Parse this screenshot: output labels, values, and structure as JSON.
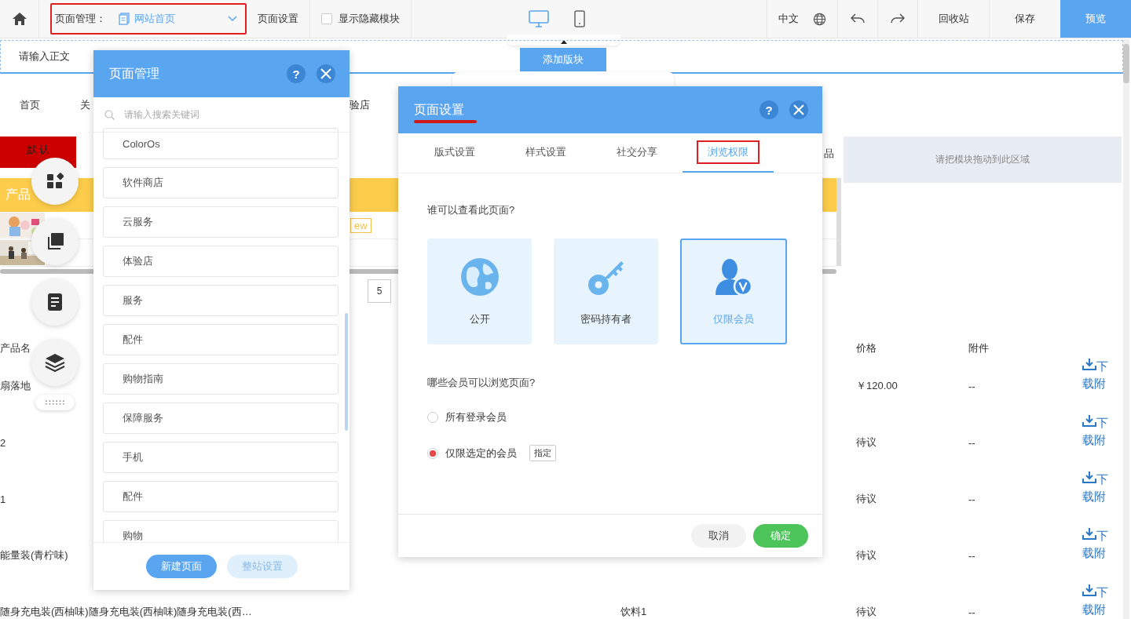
{
  "toolbar": {
    "page_label": "页面管理：",
    "page_select": "网站首页",
    "page_settings": "页面设置",
    "show_hidden": {
      "label": "显示隐藏模块",
      "checked": false
    },
    "devices": [
      {
        "kind": "desktop",
        "selected": true
      },
      {
        "kind": "mobile",
        "selected": false
      }
    ],
    "language": "中文",
    "recycle": "回收站",
    "save": "保存",
    "preview": "预览"
  },
  "canvas": {
    "text_placeholder": "请输入正文",
    "add_block": "添加版块",
    "nav": [
      "首页",
      "关",
      "验店"
    ],
    "default_button": "默 认",
    "banner": "产品",
    "tag": "ew",
    "tab_fragment": "品",
    "drop_zone": "请把模块拖动到此区域",
    "pagination": [
      "5"
    ],
    "table": {
      "columns": [
        "产品名",
        "价格",
        "附件"
      ],
      "rows": [
        {
          "name": "扇落地",
          "price": "￥120.00",
          "attachment": "--",
          "link": "下载附"
        },
        {
          "name": "2",
          "price": "待议",
          "attachment": "--",
          "link": "下载附"
        },
        {
          "name": "1",
          "price": "待议",
          "attachment": "--",
          "link": "下载附"
        },
        {
          "name": "能量装(青柠味)",
          "price": "待议",
          "attachment": "--",
          "link": "下载附"
        },
        {
          "name": "随身充电装(西柚味)随身充电装(西柚味)随身充电装(西…",
          "category": "饮料1",
          "price": "待议",
          "attachment": "--",
          "link": "下载附"
        }
      ]
    }
  },
  "page_manager": {
    "title": "页面管理",
    "help": "?",
    "search_placeholder": "请输入搜索关键词",
    "pages": [
      "ColorOs",
      "软件商店",
      "云服务",
      "体验店",
      "服务",
      "配件",
      "购物指南",
      "保障服务",
      "手机",
      "配件",
      "购物"
    ],
    "buttons": [
      {
        "label": "新建页面",
        "kind": "primary"
      },
      {
        "label": "整站设置",
        "kind": "secondary"
      }
    ]
  },
  "page_settings": {
    "title": "页面设置",
    "help": "?",
    "tabs": [
      {
        "label": "版式设置",
        "selected": false
      },
      {
        "label": "样式设置",
        "selected": false
      },
      {
        "label": "社交分享",
        "selected": false
      },
      {
        "label": "浏览权限",
        "selected": true
      }
    ],
    "question_1": "谁可以查看此页面?",
    "access": [
      {
        "label": "公开",
        "kind": "globe",
        "selected": false
      },
      {
        "label": "密码持有者",
        "kind": "key",
        "selected": false
      },
      {
        "label": "仅限会员",
        "kind": "member",
        "selected": true
      }
    ],
    "question_2": "哪些会员可以浏览页面?",
    "members": [
      {
        "label": "所有登录会员",
        "selected": false
      },
      {
        "label": "仅限选定的会员",
        "selected": true,
        "action": "指定"
      }
    ],
    "cancel": "取消",
    "confirm": "确定"
  }
}
